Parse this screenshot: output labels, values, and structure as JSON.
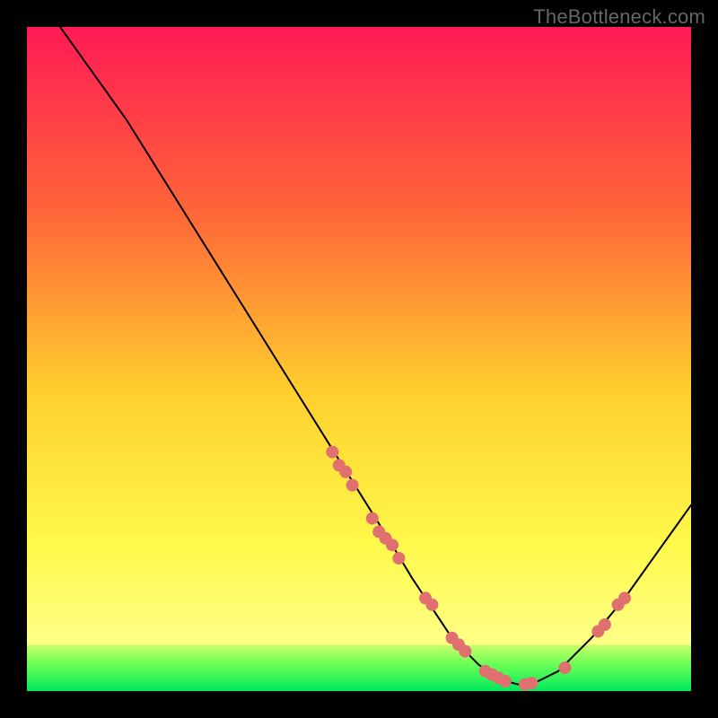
{
  "watermark": "TheBottleneck.com",
  "chart_data": {
    "type": "line",
    "title": "",
    "xlabel": "",
    "ylabel": "",
    "xlim": [
      0,
      100
    ],
    "ylim": [
      0,
      100
    ],
    "background_gradient": {
      "top": "#ff1a55",
      "mid1": "#ff8d2e",
      "mid2": "#ffe932",
      "mid3": "#ffff55",
      "bottom_band": "#00e85d"
    },
    "curve": {
      "name": "bottleneck-curve",
      "color": "#000000",
      "stroke_width": 2,
      "x": [
        5,
        10,
        15,
        20,
        25,
        30,
        35,
        40,
        45,
        50,
        55,
        58,
        60,
        62,
        64,
        66,
        68,
        70,
        72,
        74,
        77,
        80,
        85,
        90,
        95,
        100
      ],
      "y": [
        100,
        93,
        86,
        78,
        70,
        62,
        54,
        46,
        38,
        30,
        22,
        17,
        14,
        11,
        8,
        6,
        4,
        2.5,
        1.5,
        1,
        1.5,
        3,
        8,
        14,
        21,
        28
      ]
    },
    "points": {
      "name": "sample-dots",
      "color": "#e07070",
      "radius": 7,
      "data": [
        {
          "x": 46,
          "y": 36
        },
        {
          "x": 47,
          "y": 34
        },
        {
          "x": 48,
          "y": 33
        },
        {
          "x": 49,
          "y": 31
        },
        {
          "x": 52,
          "y": 26
        },
        {
          "x": 53,
          "y": 24
        },
        {
          "x": 54,
          "y": 23
        },
        {
          "x": 55,
          "y": 22
        },
        {
          "x": 56,
          "y": 20
        },
        {
          "x": 60,
          "y": 14
        },
        {
          "x": 61,
          "y": 13
        },
        {
          "x": 64,
          "y": 8
        },
        {
          "x": 65,
          "y": 7
        },
        {
          "x": 66,
          "y": 6
        },
        {
          "x": 69,
          "y": 3
        },
        {
          "x": 70,
          "y": 2.5
        },
        {
          "x": 71,
          "y": 2
        },
        {
          "x": 72,
          "y": 1.5
        },
        {
          "x": 75,
          "y": 1
        },
        {
          "x": 76,
          "y": 1.2
        },
        {
          "x": 81,
          "y": 3.5
        },
        {
          "x": 86,
          "y": 9
        },
        {
          "x": 87,
          "y": 10
        },
        {
          "x": 89,
          "y": 13
        },
        {
          "x": 90,
          "y": 14
        }
      ]
    }
  }
}
